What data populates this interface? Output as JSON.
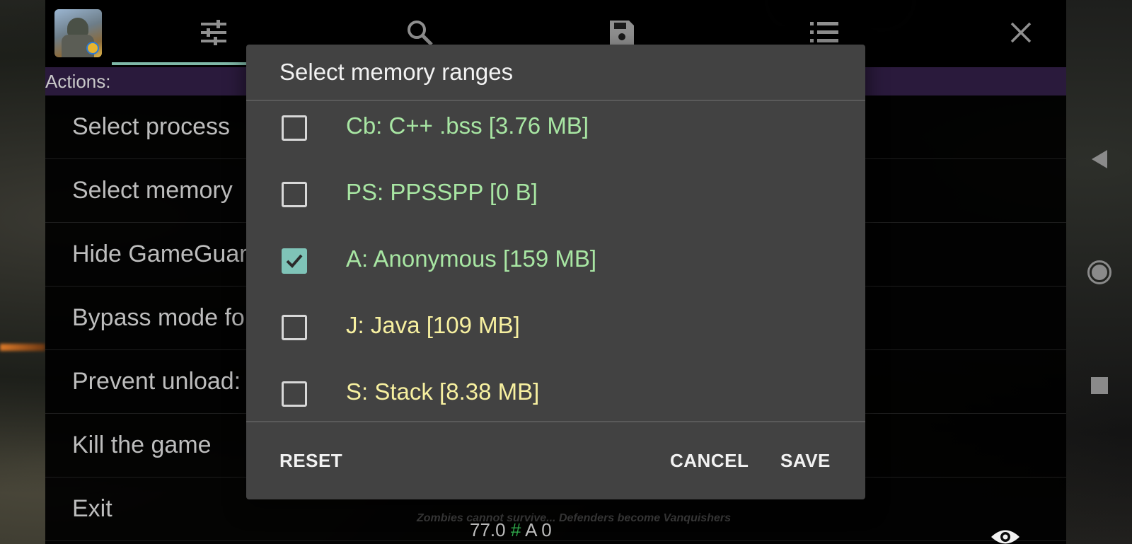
{
  "toolbar": {
    "icons": [
      "app-icon",
      "sliders-icon",
      "search-icon",
      "save-icon",
      "list-icon",
      "close-icon"
    ]
  },
  "actions_header": "Actions:",
  "menu": {
    "items": [
      "Select process",
      "Select memory",
      "Hide GameGuar",
      "Bypass mode fo",
      "Prevent unload:",
      "Kill the game",
      "Exit"
    ]
  },
  "status": {
    "banner": "Zombies cannot survive... Defenders become Vanquishers",
    "value": "77.0",
    "hash": "#",
    "region": "A 0"
  },
  "dialog": {
    "title": "Select memory ranges",
    "ranges": [
      {
        "label": "Cb: C++ .bss [3.76 MB]",
        "checked": false,
        "color": "#a8e6a3"
      },
      {
        "label": "PS: PPSSPP [0 B]",
        "checked": false,
        "color": "#a8e6a3"
      },
      {
        "label": "A: Anonymous [159 MB]",
        "checked": true,
        "color": "#a8e6a3"
      },
      {
        "label": "J: Java [109 MB]",
        "checked": false,
        "color": "#f7f0a0"
      },
      {
        "label": "S: Stack [8.38 MB]",
        "checked": false,
        "color": "#f7f0a0"
      }
    ],
    "reset_label": "RESET",
    "cancel_label": "CANCEL",
    "save_label": "SAVE"
  },
  "nav": {
    "icons": [
      "back-icon",
      "home-icon",
      "recents-icon"
    ]
  },
  "colors": {
    "accent": "#7fc4b8",
    "actions_bar": "#2a1a3c",
    "dialog_bg": "#424242"
  }
}
